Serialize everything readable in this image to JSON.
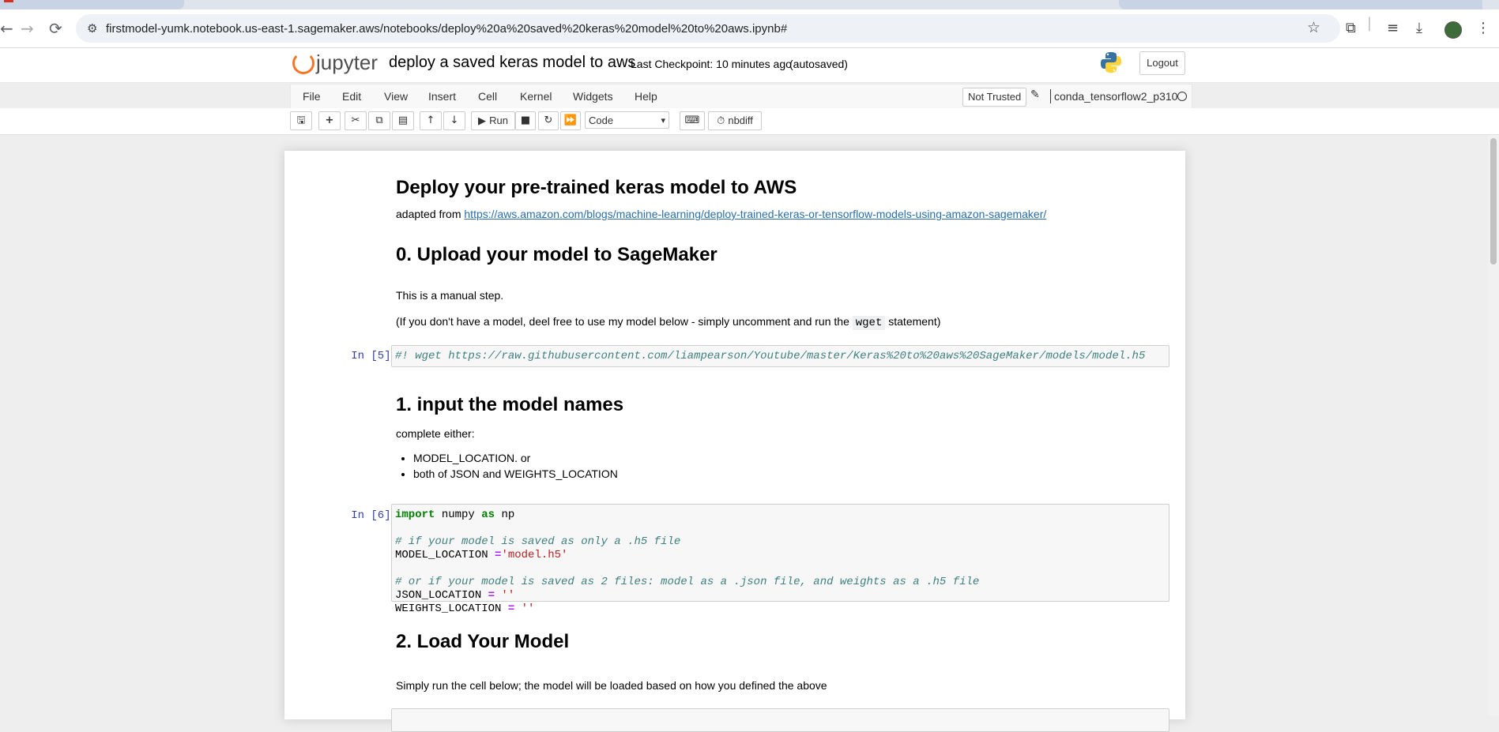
{
  "browser": {
    "url": "firstmodel-yumk.notebook.us-east-1.sagemaker.aws/notebooks/deploy%20a%20saved%20keras%20model%20to%20aws.ipynb#"
  },
  "header": {
    "logo_text": "jupyter",
    "notebook_title": "deploy a saved keras model to aws",
    "checkpoint": "Last Checkpoint: 10 minutes ago",
    "autosaved": "(autosaved)",
    "logout_label": "Logout"
  },
  "menubar": {
    "items": [
      "File",
      "Edit",
      "View",
      "Insert",
      "Cell",
      "Kernel",
      "Widgets",
      "Help"
    ],
    "trust_label": "Not Trusted",
    "kernel_name": "conda_tensorflow2_p310"
  },
  "toolbar": {
    "run_label": "Run",
    "cell_type": "Code",
    "nbdiff_label": "nbdiff"
  },
  "notebook": {
    "title": "Deploy your pre-trained keras model to AWS",
    "adapted_prefix": "adapted from ",
    "adapted_link": "https://aws.amazon.com/blogs/machine-learning/deploy-trained-keras-or-tensorflow-models-using-amazon-sagemaker/",
    "section0_heading": "0. Upload your model to SageMaker",
    "section0_p1": "This is a manual step.",
    "section0_p2_a": "(If you don't have a model, deel free to use my model below - simply uncomment and run the ",
    "section0_p2_code": "wget",
    "section0_p2_b": " statement)",
    "cell5_prompt": "In [5]:",
    "cell5_code": "#! wget https://raw.githubusercontent.com/liampearson/Youtube/master/Keras%20to%20aws%20SageMaker/models/model.h5",
    "section1_heading": "1. input the model names",
    "section1_p": "complete either:",
    "section1_bullets": [
      "MODEL_LOCATION. or",
      "both of JSON and WEIGHTS_LOCATION"
    ],
    "cell6_prompt": "In [6]:",
    "cell6_import_kw": "import",
    "cell6_import_mod": " numpy ",
    "cell6_as_kw": "as",
    "cell6_alias": " np",
    "cell6_comment1": "# if your model is saved as only a .h5 file",
    "cell6_model_loc_var": "MODEL_LOCATION ",
    "cell6_model_loc_op": "=",
    "cell6_model_loc_val": "'model.h5'",
    "cell6_comment2": "# or if your model is saved as 2 files: model as a .json file, and weights as a .h5 file",
    "cell6_json_var": "JSON_LOCATION ",
    "cell6_json_op": "=",
    "cell6_json_val": " ''",
    "cell6_weights_var": "WEIGHTS_LOCATION ",
    "cell6_weights_op": "=",
    "cell6_weights_val": " ''",
    "section2_heading": "2. Load Your Model",
    "section2_p": "Simply run the cell below; the model will be loaded based on how you defined the above"
  }
}
